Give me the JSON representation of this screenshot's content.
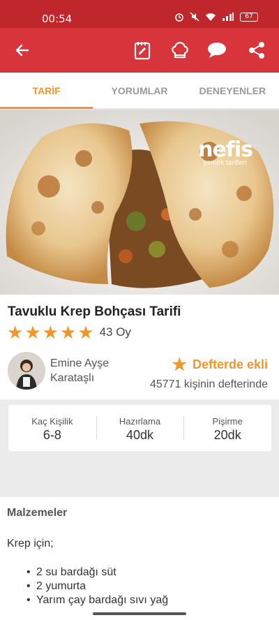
{
  "status_bar": {
    "time": "00:54",
    "battery": "67"
  },
  "toolbar": {
    "back": "arrow-left-icon",
    "actions": [
      "notebook-icon",
      "chef-hat-icon",
      "comment-icon",
      "share-icon"
    ]
  },
  "tabs": [
    {
      "label": "TARİF",
      "active": true
    },
    {
      "label": "YORUMLAR",
      "active": false
    },
    {
      "label": "DENEYENLER",
      "active": false
    }
  ],
  "hero": {
    "logo_main": "nefis",
    "logo_sub": "yemek tarifleri"
  },
  "recipe": {
    "title": "Tavuklu Krep Bohçası Tarifi",
    "rating": 5,
    "votes": "43 Oy",
    "author": "Emine Ayşe Karataşlı",
    "favorite_label": "Defterde ekli",
    "favorite_count": "45771 kişinin defterinde"
  },
  "stats": [
    {
      "label": "Kaç Kişilik",
      "value": "6-8"
    },
    {
      "label": "Hazırlama",
      "value": "40dk"
    },
    {
      "label": "Pişirme",
      "value": "20dk"
    }
  ],
  "ingredients": {
    "title": "Malzemeler",
    "section": "Krep için;",
    "items": [
      "2 su bardağı süt",
      "2 yumurta",
      "Yarım çay bardağı sıvı yağ"
    ]
  },
  "colors": {
    "primary": "#d8343b",
    "statusbar": "#c0272d",
    "accent": "#f0962a"
  }
}
